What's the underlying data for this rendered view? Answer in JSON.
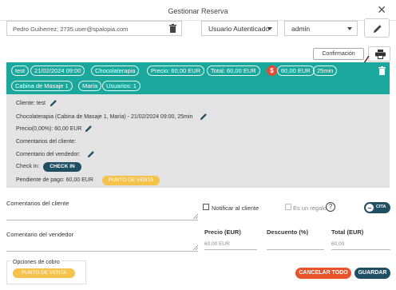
{
  "window": {
    "title": "Gestionar Reserva",
    "close_glyph": "✕"
  },
  "header": {
    "user_value": "Pedro  Guiherrez; 2735.user@spalopia.com",
    "auth_select": "Usuario Autenticado",
    "role_select": "admin"
  },
  "actions": {
    "confirmation_label": "Confirmación"
  },
  "summary_chips": {
    "client": "test",
    "date": "21/02/2024 09:00",
    "service": "Chocolaterapia",
    "price": "Precio: 60,00 EUR",
    "total": "Total: 60,00 EUR",
    "dollar": "$",
    "paid": "60,00 EUR",
    "duration": "25min",
    "cabin": "Cabina de Masaje 1",
    "staff": "María",
    "users": "Usuarios: 1"
  },
  "details": {
    "client": "Cliente: test",
    "service_line": "Chocolaterapia (Cabina de Masaje 1, María) - 21/02/2024 09:00, 25min",
    "price": "Precio(0,00%): 60,00 EUR",
    "client_comments": "Comentarios del cliente:",
    "seller_comments": "Comentario del vendedor:",
    "checkin_label": "Check in:",
    "checkin_button": "CHECK IN",
    "pending": "Pendiente de pago:  60,00 EUR",
    "pos_button": "PUNTO DE VENTA"
  },
  "form": {
    "client_comments_label": "Comentarios del cliente",
    "seller_comment_label": "Comentario del vendedor",
    "notify_label": "Notificar al cliente",
    "gift_label": "Es un regalo",
    "help_glyph": "?",
    "toggle_label": "CITA",
    "price_label": "Precio (EUR)",
    "price_value": "60,00 EUR",
    "discount_label": "Descuento (%)",
    "total_label": "Total (EUR)",
    "total_value": "60,00"
  },
  "footer": {
    "payment_options_label": "Opciones de cobro",
    "pos_button": "PUNTO DE VENTA",
    "cancel_all": "CANCELAR TODO",
    "save": "GUARDAR"
  },
  "colors": {
    "teal": "#1ba89c",
    "dark_teal": "#1e4f63",
    "yellow": "#f5c34b",
    "orange": "#e8532a",
    "red_dollar": "#e34c32",
    "details_bg": "#e3e3e3"
  }
}
